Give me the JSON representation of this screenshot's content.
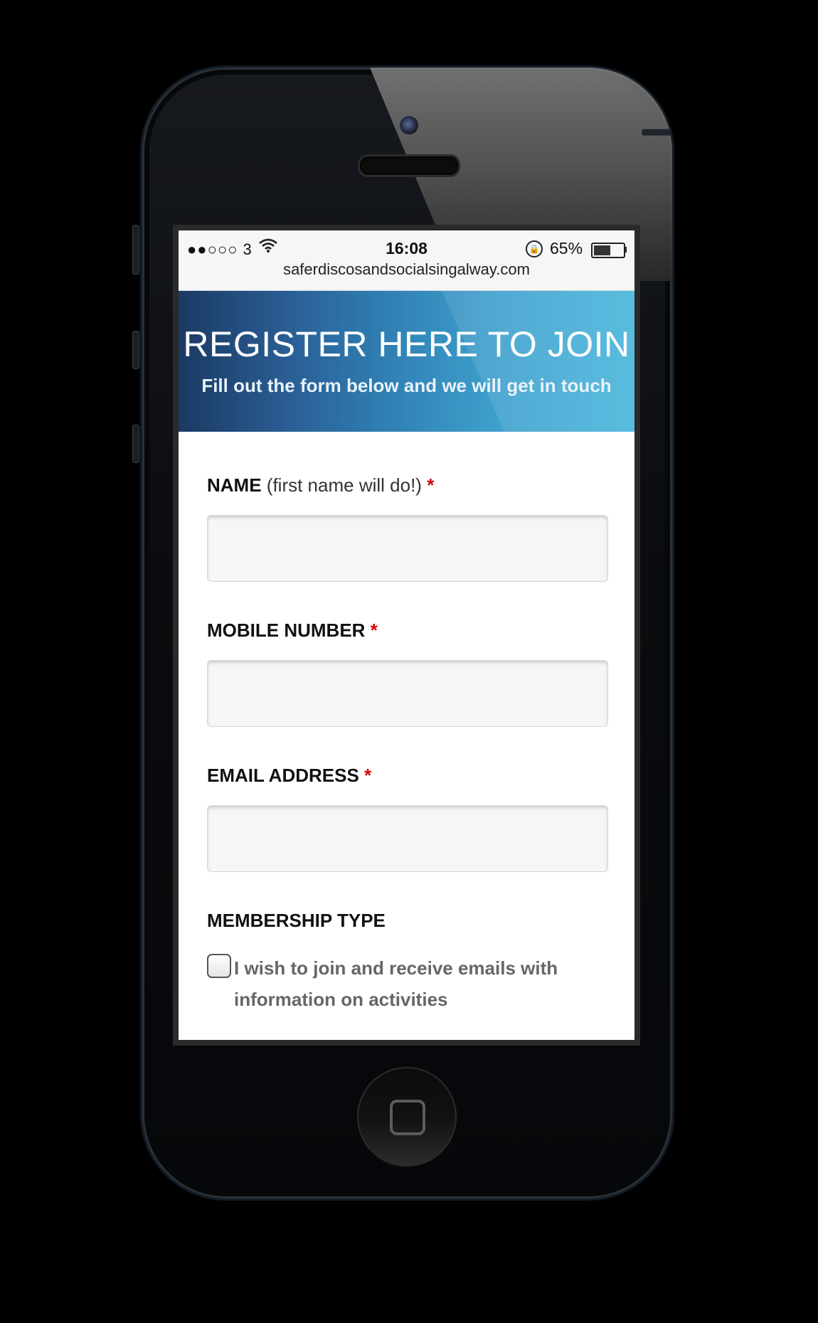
{
  "status_bar": {
    "signal": "●●○○○ 3",
    "time": "16:08",
    "battery_percent": "65%",
    "battery_level": 0.65
  },
  "browser": {
    "url": "saferdiscosandsocialsingalway.com"
  },
  "hero": {
    "title": "REGISTER HERE TO JOIN",
    "subtitle": "Fill out the form below and we will get in touch"
  },
  "form": {
    "name": {
      "label": "NAME",
      "note": "(first name will do!)",
      "required": "*",
      "value": ""
    },
    "mobile": {
      "label": "MOBILE NUMBER",
      "required": "*",
      "value": ""
    },
    "email": {
      "label": "EMAIL ADDRESS",
      "required": "*",
      "value": ""
    },
    "membership": {
      "label": "MEMBERSHIP TYPE",
      "option": "I wish to join and receive emails with information on activities",
      "checked": false
    }
  },
  "colors": {
    "hero_left": "#1b3a63",
    "hero_right": "#47b5dc",
    "required": "#d40000"
  }
}
